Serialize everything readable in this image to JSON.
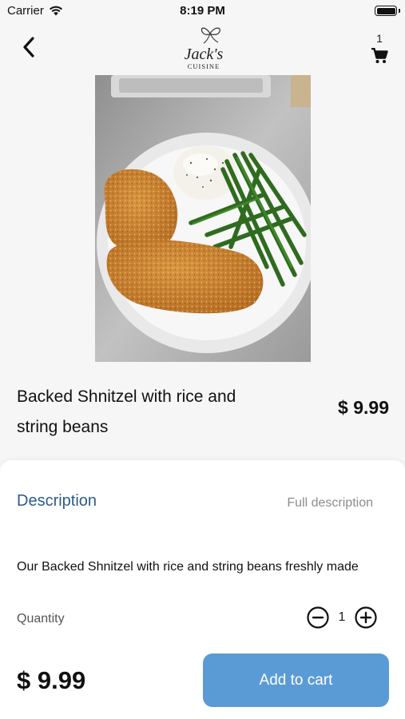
{
  "status_bar": {
    "carrier": "Carrier",
    "time": "8:19 PM"
  },
  "nav": {
    "logo_text": "Jack's",
    "logo_subtext": "CUISINE",
    "cart_count": "1"
  },
  "product": {
    "title": "Backed Shnitzel with rice and string beans",
    "price": "$ 9.99"
  },
  "tabs": {
    "description_label": "Description",
    "full_description_label": "Full description"
  },
  "description": {
    "text": "Our Backed Shnitzel with rice and string beans freshly made"
  },
  "quantity": {
    "label": "Quantity",
    "value": "1"
  },
  "footer": {
    "total_price": "$ 9.99",
    "add_to_cart_label": "Add to cart"
  },
  "colors": {
    "accent": "#5b9bd5",
    "description_tab": "#2e5a8a",
    "muted": "#8c8c8c"
  }
}
